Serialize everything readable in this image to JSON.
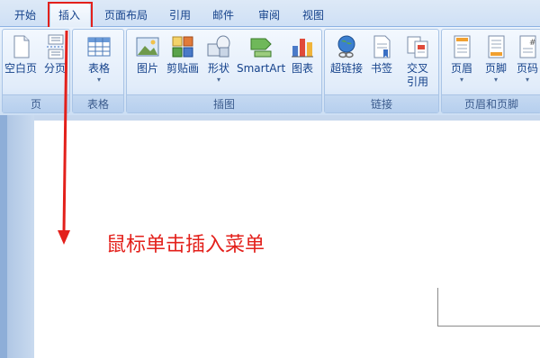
{
  "tabs": [
    {
      "label": "开始"
    },
    {
      "label": "插入"
    },
    {
      "label": "页面布局"
    },
    {
      "label": "引用"
    },
    {
      "label": "邮件"
    },
    {
      "label": "审阅"
    },
    {
      "label": "视图"
    }
  ],
  "ribbon": {
    "pages": {
      "label": "页",
      "blank_page": "空白页",
      "page_break": "分页"
    },
    "tables": {
      "label": "表格",
      "table": "表格"
    },
    "illustrations": {
      "label": "插图",
      "picture": "图片",
      "clip_art": "剪贴画",
      "shapes": "形状",
      "smartart": "SmartArt",
      "chart": "图表"
    },
    "links": {
      "label": "链接",
      "hyperlink": "超链接",
      "bookmark": "书签",
      "cross_ref_line1": "交叉",
      "cross_ref_line2": "引用"
    },
    "header_footer": {
      "label": "页眉和页脚",
      "header": "页眉",
      "footer": "页脚",
      "page_number": "页码"
    }
  },
  "annotation": {
    "text": "鼠标单击插入菜单",
    "color": "#e3201b"
  },
  "colors": {
    "accent_red": "#e3201b",
    "ribbon_text": "#15428b"
  }
}
